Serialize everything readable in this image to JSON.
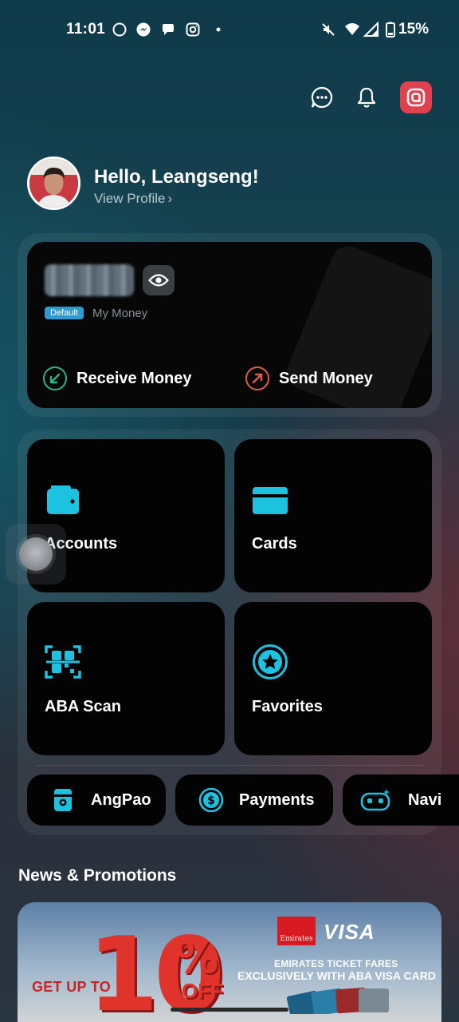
{
  "status_bar": {
    "time": "11:01",
    "battery": "15%",
    "left_icons": [
      "circle-icon",
      "messenger-icon",
      "chat-bubble-icon",
      "instagram-icon",
      "dot-icon"
    ],
    "right_icons": [
      "mute-icon",
      "wifi-icon",
      "signal-icon",
      "battery-icon"
    ]
  },
  "header": {
    "icons": [
      "chat-icon",
      "bell-icon",
      "aba-logo-icon"
    ],
    "accent": "#e0414e"
  },
  "profile": {
    "greeting": "Hello, Leangseng!",
    "view_profile": "View Profile",
    "chevron": "›"
  },
  "money_card": {
    "badge": "Default",
    "account_name": "My Money",
    "receive_label": "Receive Money",
    "send_label": "Send Money",
    "receive_color": "#2bb38a",
    "send_color": "#e05a4e"
  },
  "tiles": [
    {
      "label": "Accounts",
      "icon": "wallet-icon"
    },
    {
      "label": "Cards",
      "icon": "card-icon"
    },
    {
      "label": "ABA Scan",
      "icon": "qr-scan-icon"
    },
    {
      "label": "Favorites",
      "icon": "star-icon"
    }
  ],
  "quick_actions": [
    {
      "label": "AngPao",
      "icon": "angpao-icon"
    },
    {
      "label": "Payments",
      "icon": "dollar-icon"
    },
    {
      "label": "Navi",
      "icon": "robot-icon"
    }
  ],
  "icon_color": "#1cc2e0",
  "news": {
    "title": "News & Promotions",
    "promo": {
      "get_up_to": "GET UP TO",
      "big_number": "10",
      "percent": "%",
      "off": "OFF",
      "brand1": "Emirates",
      "brand2": "VISA",
      "line1": "EMIRATES TICKET FARES",
      "line2": "EXCLUSIVELY WITH ABA VISA CARD"
    }
  }
}
